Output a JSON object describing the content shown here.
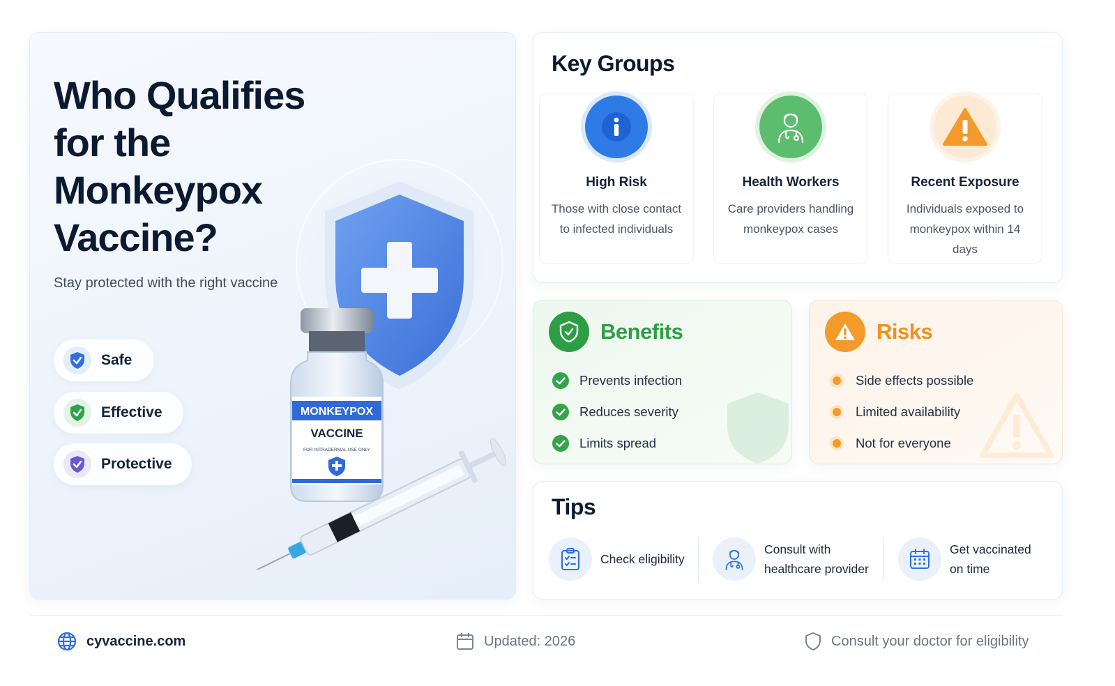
{
  "hero": {
    "title": "Who Qualifies for the Monkeypox Vaccine?",
    "subtitle": "Stay protected with the right vaccine",
    "features": [
      {
        "label": "Safe",
        "icon": "shield-check-icon",
        "color": "#2f6fe0"
      },
      {
        "label": "Effective",
        "icon": "shield-check-icon",
        "color": "#2fa24a"
      },
      {
        "label": "Protective",
        "icon": "shield-check-icon",
        "color": "#6b57d6"
      }
    ],
    "vial": {
      "brand": "MONKEYPOX",
      "name": "VACCINE",
      "note": "FOR INTRADERMAL USE ONLY"
    }
  },
  "key_groups": {
    "title": "Key Groups",
    "items": [
      {
        "title": "High Risk",
        "description": "Those with close contact to infected individuals",
        "icon": "info-icon",
        "color": "#2f7be6"
      },
      {
        "title": "Health Workers",
        "description": "Care providers handling monkeypox cases",
        "icon": "doctor-icon",
        "color": "#55b869"
      },
      {
        "title": "Recent Exposure",
        "description": "Individuals exposed to monkeypox within 14 days",
        "icon": "warning-icon",
        "color": "#f39a2a"
      }
    ]
  },
  "benefits": {
    "title": "Benefits",
    "color": "#2e9e45",
    "items": [
      "Prevents infection",
      "Reduces severity",
      "Limits spread"
    ]
  },
  "risks": {
    "title": "Risks",
    "color": "#f0901d",
    "items": [
      "Side effects possible",
      "Limited availability",
      "Not for everyone"
    ]
  },
  "tips": {
    "title": "Tips",
    "items": [
      {
        "text": "Check eligibility",
        "icon": "clipboard-check-icon"
      },
      {
        "text": "Consult with healthcare provider",
        "icon": "doctor-icon"
      },
      {
        "text": "Get vaccinated on time",
        "icon": "calendar-icon"
      }
    ]
  },
  "footer": {
    "site": "cyvaccine.com",
    "updated": "Updated: 2026",
    "note": "Consult your doctor for eligibility"
  }
}
